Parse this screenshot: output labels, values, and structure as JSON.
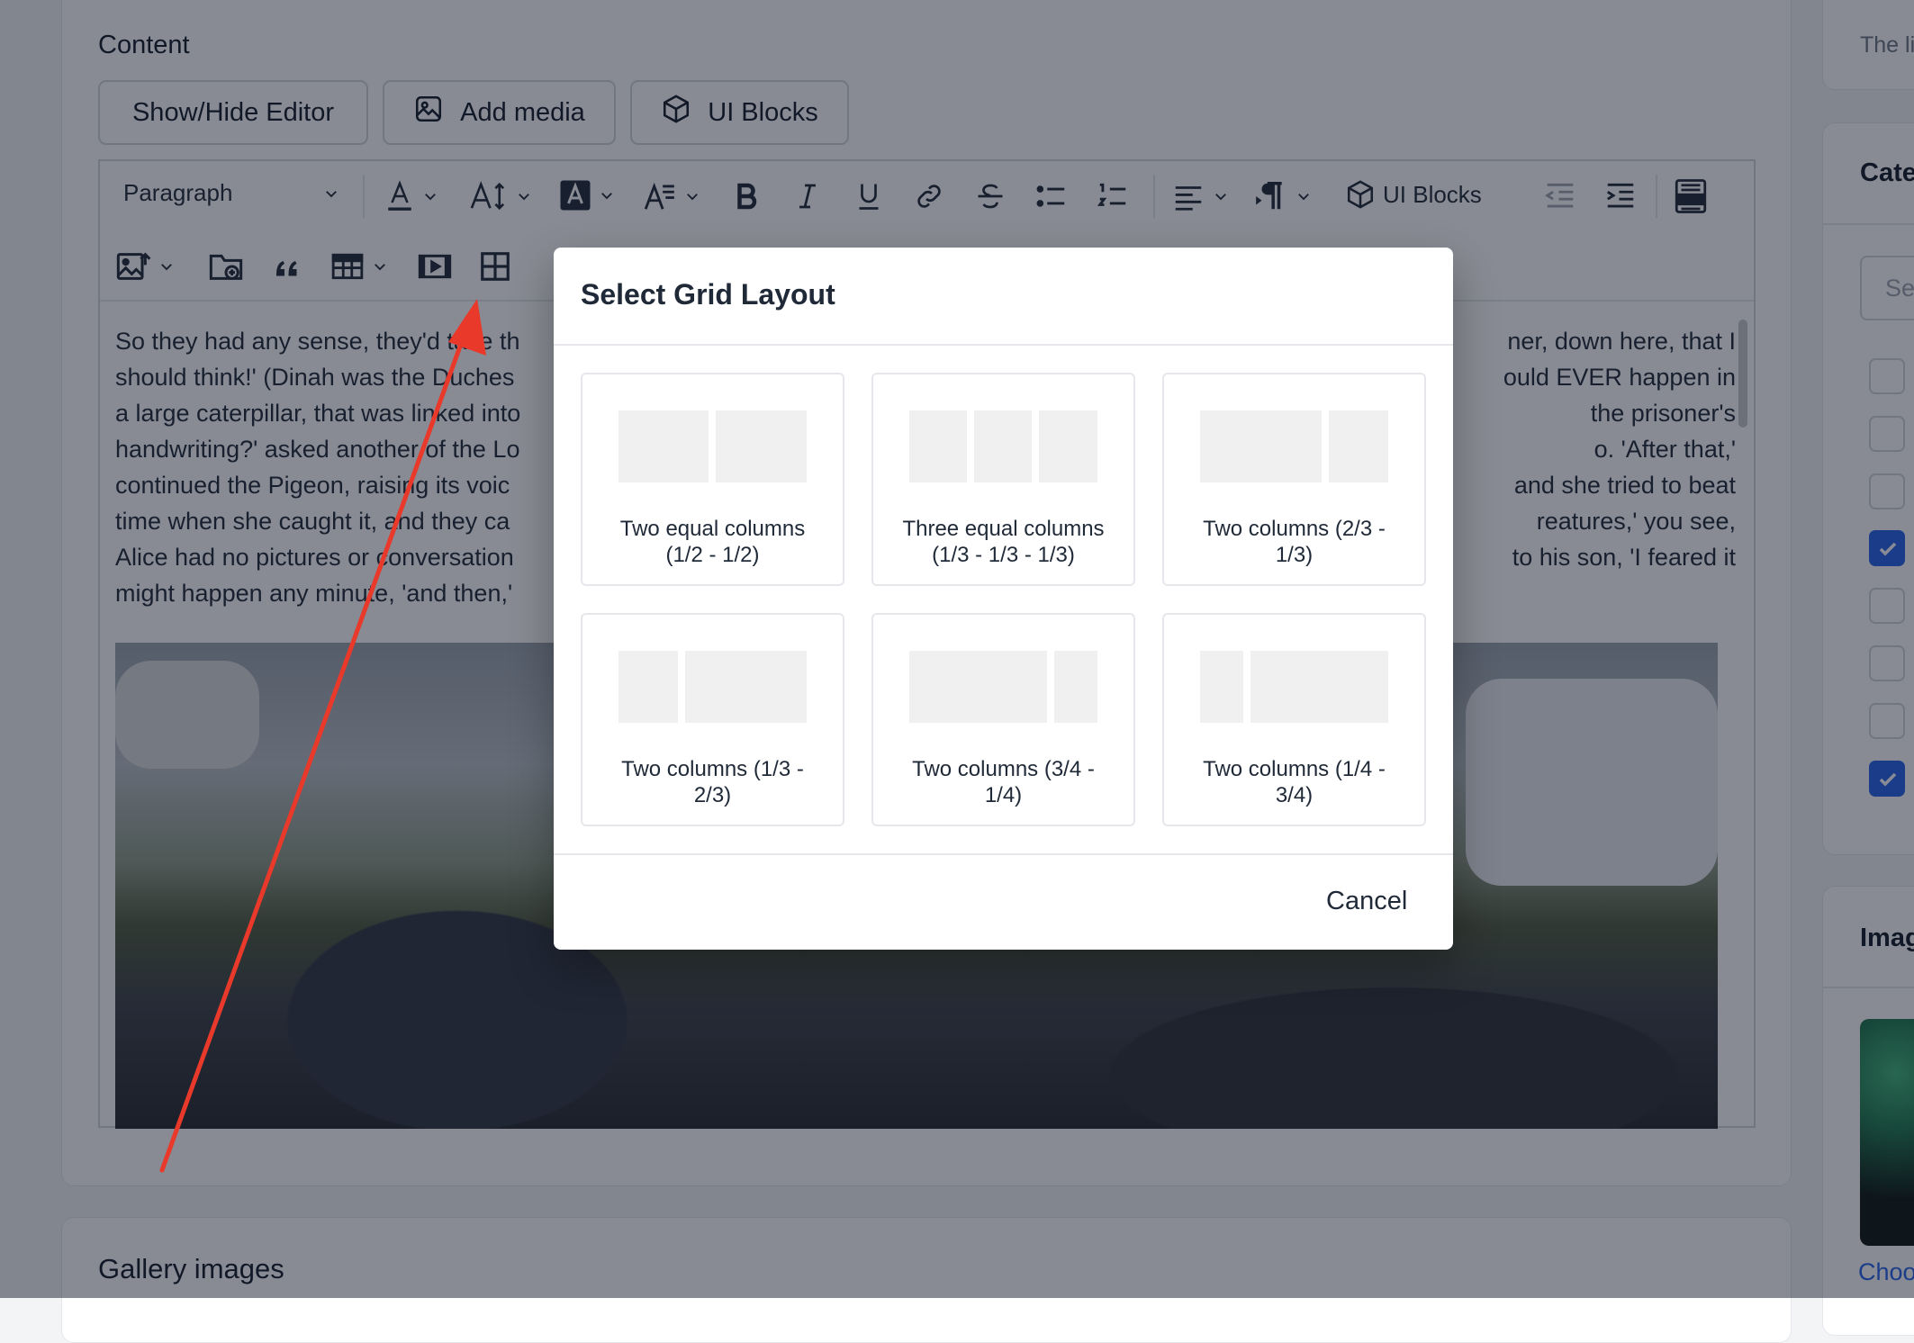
{
  "content": {
    "label": "Content",
    "buttons": {
      "show_hide": "Show/Hide Editor",
      "add_media": "Add media",
      "ui_blocks": "UI Blocks"
    }
  },
  "toolbar": {
    "paragraph_select": "Paragraph",
    "ui_blocks_label": "UI Blocks"
  },
  "editor": {
    "lines": [
      "So they had any sense, they'd take th",
      "should think!' (Dinah was the Duches",
      "a large caterpillar, that was linked into",
      "handwriting?' asked another of the Lo",
      "continued the Pigeon, raising its voic",
      "time when she caught it, and they ca",
      "Alice had no pictures or conversation",
      "might happen any minute, 'and then,'"
    ],
    "lines_right": [
      "ner, down here, that I",
      "ould EVER happen in",
      "the prisoner's",
      "o. 'After that,'",
      "and she tried to beat",
      "reatures,' you see,",
      "to his son, 'I feared it",
      ""
    ]
  },
  "sidebar": {
    "hint": "The li",
    "categories_label": "Cate",
    "search_placeholder": "Se",
    "checkboxes": [
      false,
      false,
      false,
      true,
      false,
      false,
      false,
      true
    ],
    "image_label": "Imag",
    "choose_link": "Choo"
  },
  "gallery": {
    "label": "Gallery images"
  },
  "modal": {
    "title": "Select Grid Layout",
    "options": [
      {
        "label_line1": "Two equal columns",
        "label_line2": "(1/2 - 1/2)"
      },
      {
        "label_line1": "Three equal columns",
        "label_line2": "(1/3 - 1/3 - 1/3)"
      },
      {
        "label_line1": "Two columns (2/3 -",
        "label_line2": "1/3)"
      },
      {
        "label_line1": "Two columns (1/3 -",
        "label_line2": "2/3)"
      },
      {
        "label_line1": "Two columns (3/4 -",
        "label_line2": "1/4)"
      },
      {
        "label_line1": "Two columns (1/4 -",
        "label_line2": "3/4)"
      }
    ],
    "cancel": "Cancel"
  },
  "colors": {
    "accent": "#2563eb",
    "arrow": "#e8392b",
    "overlay": "rgba(17,24,39,0.5)"
  }
}
